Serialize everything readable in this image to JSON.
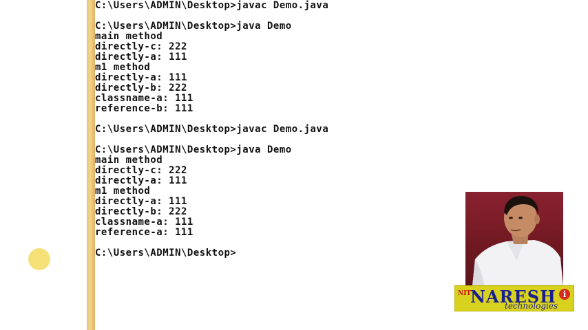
{
  "console": {
    "lines": [
      "C:\\Users\\ADMIN\\Desktop>javac Demo.java",
      "",
      "C:\\Users\\ADMIN\\Desktop>java Demo",
      "main method",
      "directly-c: 222",
      "directly-a: 111",
      "m1 method",
      "directly-a: 111",
      "directly-b: 222",
      "classname-a: 111",
      "reference-b: 111",
      "",
      "C:\\Users\\ADMIN\\Desktop>javac Demo.java",
      "",
      "C:\\Users\\ADMIN\\Desktop>java Demo",
      "main method",
      "directly-c: 222",
      "directly-a: 111",
      "m1 method",
      "directly-a: 111",
      "directly-b: 222",
      "classname-a: 111",
      "reference-a: 111",
      "",
      "C:\\Users\\ADMIN\\Desktop>"
    ]
  },
  "logo": {
    "nit": "NIT",
    "brand": "NARESH",
    "i_mark": "i",
    "tagline": "technologies"
  },
  "colors": {
    "left_bar": "#e8c070",
    "logo_bg": "#d8d21e",
    "logo_text": "#1a1f8f"
  }
}
